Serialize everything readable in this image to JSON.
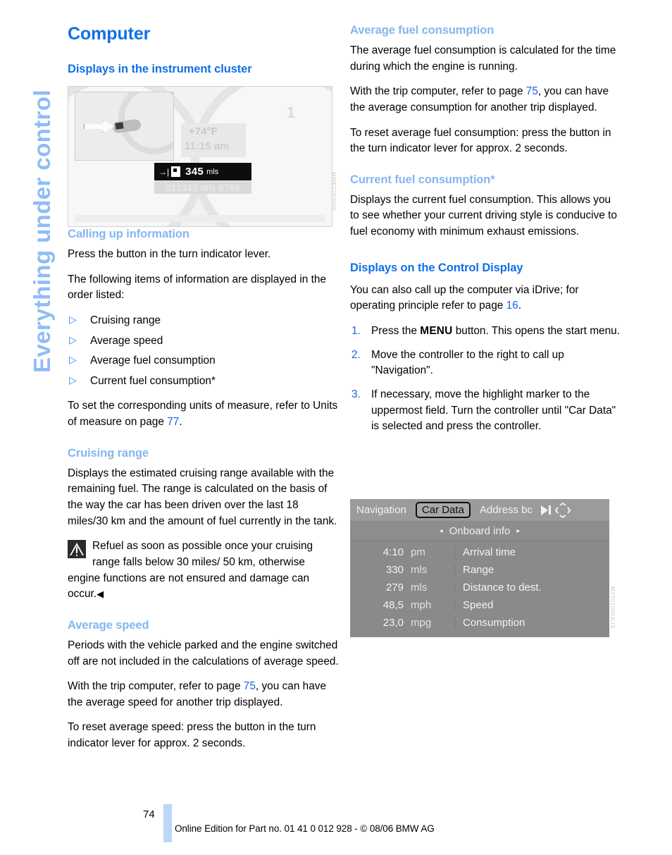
{
  "side_tab": {
    "label": "Everything under control"
  },
  "left_column": {
    "title": "Computer",
    "section_cluster_heading": "Displays in the instrument cluster",
    "calling_up": {
      "heading": "Calling up information",
      "p1": "Press the button in the turn indicator lever.",
      "p2": "The following items of information are displayed in the order listed:",
      "items": [
        "Cruising range",
        "Average speed",
        "Average fuel consumption",
        "Current fuel consumption*"
      ],
      "p3_before": "To set the corresponding units of measure, refer to Units of measure on page ",
      "p3_link": "77",
      "p3_after": "."
    },
    "cruising_range": {
      "heading": "Cruising range",
      "p1": "Displays the estimated cruising range available with the remaining fuel. The range is calculated on the basis of the way the car has been driven over the last 18 miles/30 km and the amount of fuel currently in the tank.",
      "warning": "Refuel as soon as possible once your cruising range falls below 30 miles/ 50 km, otherwise engine functions are not ensured and damage can occur.",
      "warning_endmark": "◀"
    },
    "average_speed": {
      "heading": "Average speed",
      "p1": "Periods with the vehicle parked and the engine switched off are not included in the calculations of average speed.",
      "p2_before": "With the trip computer, refer to page ",
      "p2_link": "75",
      "p2_after": ", you can have the average speed for another trip displayed.",
      "p3": "To reset average speed: press the button in the turn indicator lever for approx. 2 seconds."
    }
  },
  "right_column": {
    "average_fuel": {
      "heading": "Average fuel consumption",
      "p1": "The average fuel consumption is calculated for the time during which the engine is running.",
      "p2_before": "With the trip computer, refer to page ",
      "p2_link": "75",
      "p2_after": ", you can have the average consumption for another trip displayed.",
      "p3": "To reset average fuel consumption: press the button in the turn indicator lever for approx. 2 seconds."
    },
    "current_fuel": {
      "heading": "Current fuel consumption*",
      "p1": "Displays the current fuel consumption. This allows you to see whether your current driving style is conducive to fuel economy with minimum exhaust emissions."
    },
    "control_display": {
      "heading": "Displays on the Control Display",
      "p1_before": "You can also call up the computer via iDrive; for operating principle refer to page ",
      "p1_link": "16",
      "p1_after": ".",
      "steps": [
        {
          "num": "1.",
          "before": "Press the ",
          "button": "MENU",
          "after": " button. This opens the start menu."
        },
        {
          "num": "2.",
          "before": "Move the controller to the right to call up \"Navigation\".",
          "button": "",
          "after": ""
        },
        {
          "num": "3.",
          "before": "If necessary, move the highlight marker to the uppermost field. Turn the controller until \"Car Data\" is selected and press the controller.",
          "button": "",
          "after": ""
        }
      ]
    }
  },
  "figure_cluster": {
    "temp_value": "+74°F",
    "clock_value": "11:15 am",
    "range_value": "345",
    "range_unit": "mls",
    "odometer": "012345 mls 6789",
    "dial_mark_right": "1",
    "code": "MWF0250006"
  },
  "figure_idrive": {
    "tabs": [
      {
        "label": "Navigation",
        "selected": false
      },
      {
        "label": "Car Data",
        "selected": true
      },
      {
        "label": "Address bc",
        "selected": false
      }
    ],
    "subheader": "Onboard info",
    "arrow_left": "◂",
    "arrow_right": "▸",
    "rows": [
      {
        "value": "4:10",
        "unit": "pm",
        "label": "Arrival time"
      },
      {
        "value": "330",
        "unit": "mls",
        "label": "Range"
      },
      {
        "value": "279",
        "unit": "mls",
        "label": "Distance to dest."
      },
      {
        "value": "48,5",
        "unit": "mph",
        "label": "Speed"
      },
      {
        "value": "23,0",
        "unit": "mpg",
        "label": "Consumption"
      }
    ],
    "code": "MY0010054US"
  },
  "footer": {
    "page_number": "74",
    "imprint": "Online Edition for Part no. 01 41 0 012 928 - © 08/06 BMW AG"
  },
  "colors": {
    "heading_strong": "#1070e8",
    "heading_light": "#84b6f0",
    "link": "#1a63e0",
    "side_tab": "#8fbcf5",
    "footer_bar": "#bcd6f7"
  }
}
